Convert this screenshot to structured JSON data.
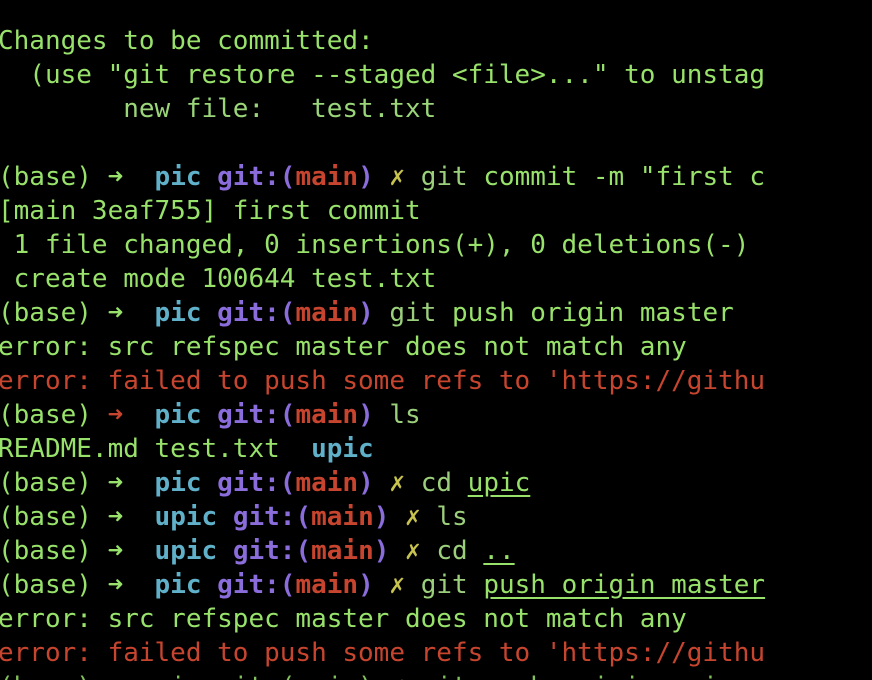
{
  "lines": {
    "l1": "Changes to be committed:",
    "l2": "  (use \"git restore --staged <file>...\" to unstag",
    "l3": "        new file:   test.txt",
    "l4_prefix": "(base) ",
    "l4_arrow": "➜",
    "l4_dir": "pic",
    "l4_git": "git:(",
    "l4_branch": "main",
    "l4_close": ")",
    "l4_x": "✗",
    "l4_cmd": "git",
    "l4_rest": " commit -m \"first c",
    "l5": "[main 3eaf755] first commit",
    "l6": " 1 file changed, 0 insertions(+), 0 deletions(-)",
    "l7": " create mode 100644 test.txt",
    "l8_cmd": "git",
    "l8_rest": " push origin master",
    "l9": "error: src refspec master does not match any",
    "l10": "error: failed to push some refs to 'https://githu",
    "l11_cmd": "ls",
    "l12_a": "README.md test.txt  ",
    "l12_b": "upic",
    "l13_cmd": "cd",
    "l13_arg": "upic",
    "l14_dir": "upic",
    "l14_cmd": "ls",
    "l15_cmd": "cd",
    "l15_arg": "..",
    "l16_cmd": "git",
    "l16_rest": "push origin master",
    "l17": "error: src refspec master does not match any",
    "l18": "error: failed to push some refs to 'https://githu",
    "l19": "(base) ➜  pic git:(main) ✗ git push origin main"
  },
  "colors": {
    "background": "#000000",
    "text_green": "#98e26b",
    "error_red": "#c7452f",
    "dir_cyan": "#5fb0c8",
    "git_purple": "#8a6cdb",
    "dirty_yellow": "#c8c24e"
  }
}
